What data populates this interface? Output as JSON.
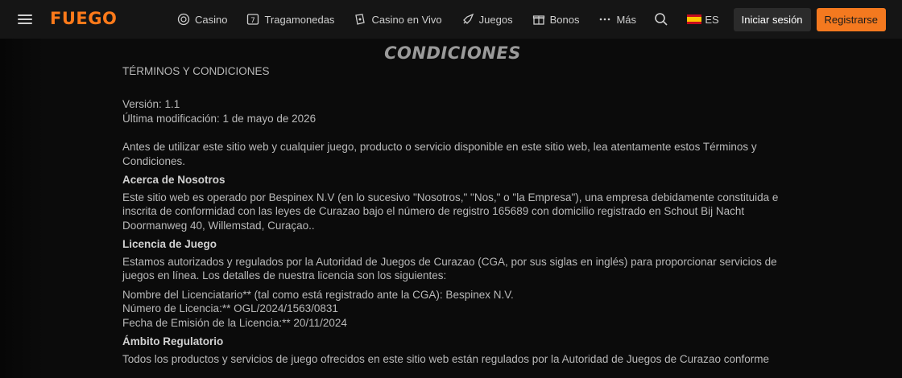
{
  "header": {
    "logo": "FUEGO",
    "nav": [
      {
        "label": "Casino",
        "icon": "casino-chip-icon"
      },
      {
        "label": "Tragamonedas",
        "icon": "slot-machine-icon"
      },
      {
        "label": "Casino en Vivo",
        "icon": "live-casino-icon"
      },
      {
        "label": "Juegos",
        "icon": "rocket-icon"
      },
      {
        "label": "Bonos",
        "icon": "gift-icon"
      },
      {
        "label": "Más",
        "icon": "more-dots-icon"
      }
    ],
    "language": "ES",
    "login_label": "Iniciar sesión",
    "register_label": "Registrarse",
    "colors": {
      "accent": "#f4791f",
      "header_bg": "#151515",
      "page_bg": "#0b0b0b"
    }
  },
  "content": {
    "title": "CONDICIONES",
    "subtitle": "TÉRMINOS Y CONDICIONES",
    "version": "Versión: 1.1",
    "modified": "Última modificación: 1 de mayo de 2026",
    "intro": "Antes de utilizar este sitio web y cualquier juego, producto o servicio disponible en este sitio web, lea atentamente estos Términos y Condiciones.",
    "about_heading": "Acerca de Nosotros",
    "about_text": "Este sitio web es operado por Bespinex N.V (en lo sucesivo \"Nosotros,\" \"Nos,\" o \"la Empresa\"), una empresa debidamente constituida e inscrita de conformidad con las leyes de Curazao bajo el número de registro 165689   con domicilio registrado en Schout Bij Nacht Doormanweg 40, Willemstad, Curaçao..",
    "license_heading": "Licencia de Juego",
    "license_text": "Estamos autorizados y regulados por la Autoridad de Juegos de Curazao (CGA, por sus siglas en inglés) para proporcionar servicios de juegos en línea. Los detalles de nuestra licencia son los siguientes:",
    "licensee": "Nombre del Licenciatario** (tal como está registrado ante la CGA): Bespinex N.V.",
    "license_number": "Número de Licencia:** OGL/2024/1563/0831",
    "issue_date": "Fecha de Emisión de la Licencia:** 20/11/2024",
    "scope_heading": "Ámbito Regulatorio",
    "scope_text": "Todos los productos y servicios de juego ofrecidos en este sitio web están regulados por la Autoridad de Juegos de Curazao conforme"
  }
}
